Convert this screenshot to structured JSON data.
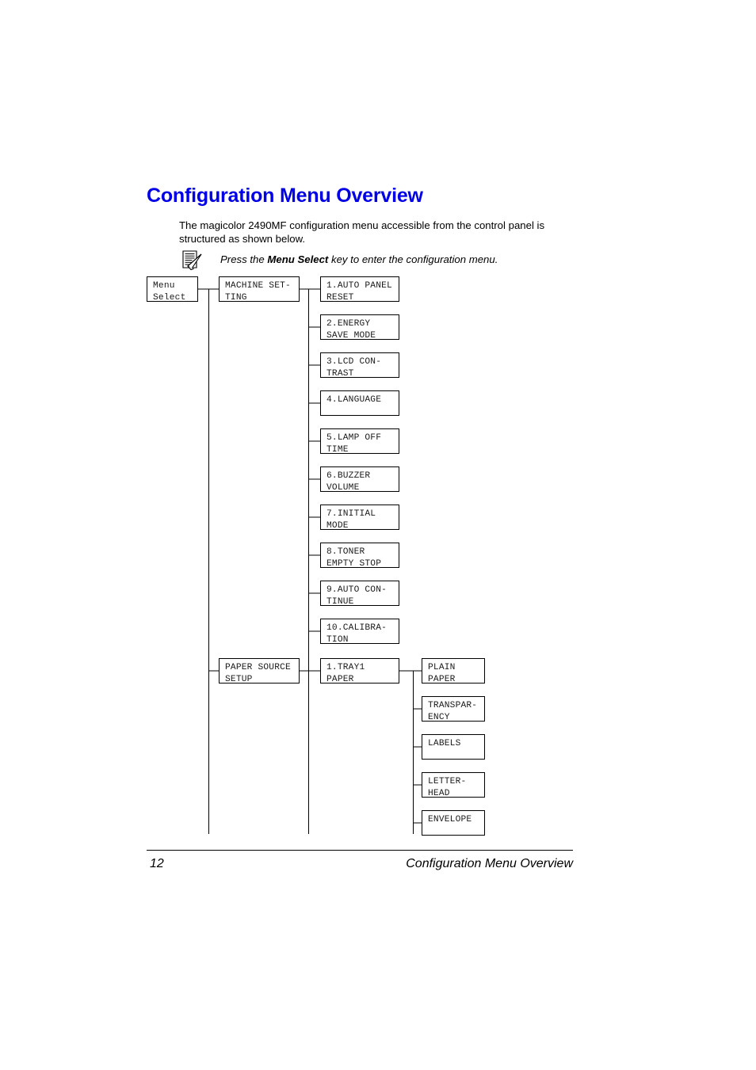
{
  "page": {
    "title": "Configuration Menu Overview",
    "title_color": "#0000e6",
    "intro": "The magicolor 2490MF configuration menu accessible from the control panel is structured as shown below.",
    "note": {
      "icon": "note-document-pen-icon",
      "text_before": "Press the ",
      "text_bold": "Menu Select",
      "text_after": " key to enter the configuration menu."
    }
  },
  "footer": {
    "page_number": "12",
    "section_title": "Configuration Menu Overview"
  },
  "diagram": {
    "root": {
      "label": "Menu\nSelect"
    },
    "level1": [
      {
        "label": "MACHINE SET-\nTING"
      },
      {
        "label": "PAPER SOURCE\nSETUP"
      }
    ],
    "machine_setting_items": [
      {
        "label": "1.AUTO PANEL\nRESET"
      },
      {
        "label": "2.ENERGY\nSAVE MODE"
      },
      {
        "label": "3.LCD CON-\nTRAST"
      },
      {
        "label": "4.LANGUAGE"
      },
      {
        "label": "5.LAMP OFF\nTIME"
      },
      {
        "label": "6.BUZZER\nVOLUME"
      },
      {
        "label": "7.INITIAL\nMODE"
      },
      {
        "label": "8.TONER\nEMPTY STOP"
      },
      {
        "label": "9.AUTO CON-\nTINUE"
      },
      {
        "label": "10.CALIBRA-\nTION"
      }
    ],
    "paper_source_items": [
      {
        "label": "1.TRAY1\nPAPER"
      }
    ],
    "tray1_paper_types": [
      {
        "label": "PLAIN\nPAPER"
      },
      {
        "label": "TRANSPAR-\nENCY"
      },
      {
        "label": "LABELS"
      },
      {
        "label": "LETTER-\nHEAD"
      },
      {
        "label": "ENVELOPE"
      }
    ]
  }
}
